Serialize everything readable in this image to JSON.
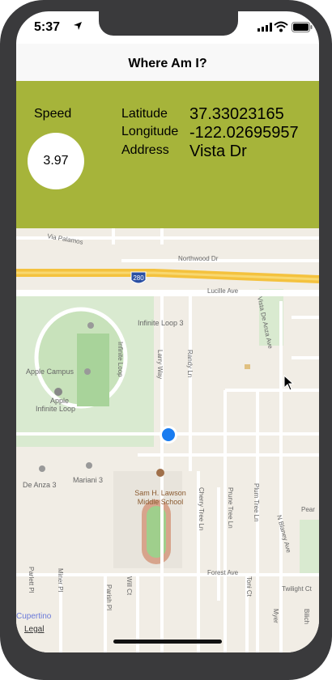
{
  "status_bar": {
    "time": "5:37"
  },
  "nav": {
    "title": "Where Am I?"
  },
  "speed": {
    "label": "Speed",
    "value": "3.97"
  },
  "location": {
    "latitude_label": "Latitude",
    "latitude_value": "37.33023165",
    "longitude_label": "Longitude",
    "longitude_value": "-122.02695957",
    "address_label": "Address",
    "address_value": "Vista Dr"
  },
  "map": {
    "labels": {
      "via_palamos": "Via Palamos",
      "northwood": "Northwood Dr",
      "highway": "280",
      "lucille": "Lucille Ave",
      "vista": "Vista De Anza Ave",
      "infinite_loop3": "Infinite Loop 3",
      "infinite_loop_st": "Infinite Loop",
      "larry_way": "Larry Way",
      "randy_ln": "Randy Ln",
      "apple_campus": "Apple Campus",
      "apple_infinite_loop": [
        "Apple",
        "Infinite Loop"
      ],
      "de_anza3": "De Anza 3",
      "mariani3": "Mariani 3",
      "school": [
        "Sam H. Lawson",
        "Middle School"
      ],
      "cherry": "Cherry Tree Ln",
      "prune": "Prune Tree Ln",
      "plum": "Plum Tree Ln",
      "n_blaney": "N Blaney Ave",
      "pear": "Pear",
      "forest": "Forest Ave",
      "twilight": "Twilight Ct",
      "parlett": "Parlett Pl",
      "miner": "Miner Pl",
      "parish": "Parish Pl",
      "will": "Will Ct",
      "toni": "Toni Ct",
      "myer": "Myer",
      "bilich": "Bilich"
    },
    "cupertino": "Cupertino",
    "legal": "Legal"
  }
}
